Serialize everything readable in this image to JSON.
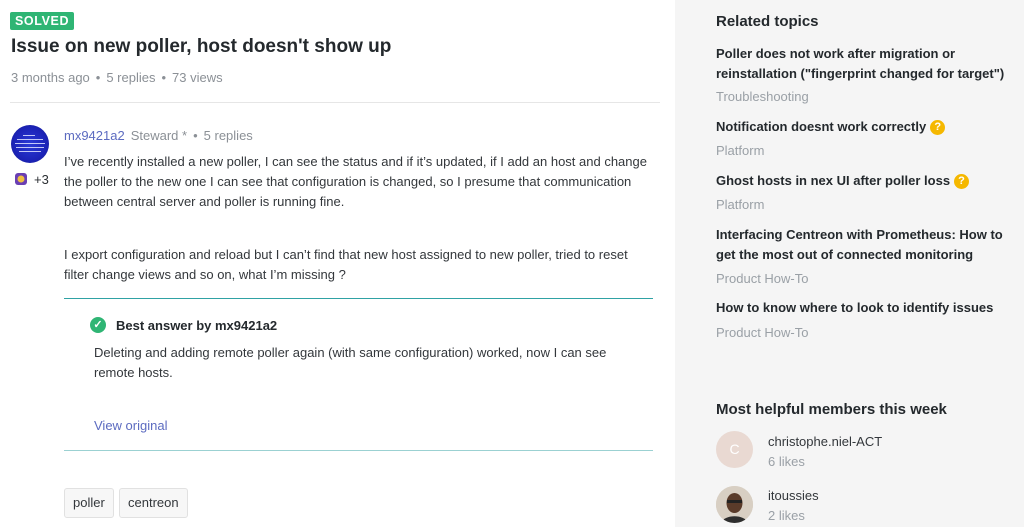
{
  "topic": {
    "status_badge": "SOLVED",
    "title": "Issue on new poller, host doesn't show up",
    "age": "3 months ago",
    "replies": "5 replies",
    "views": "73 views"
  },
  "post": {
    "author": "mx9421a2",
    "role": "Steward *",
    "replies": "5 replies",
    "badge_count": "+3",
    "paragraphs": [
      "I’ve recently installed a new poller, I can see the status and if it’s updated, if I add an host and change the poller to the new one I can see that configuration is changed, so I presume that communication between central server and poller is running fine.",
      "I export configuration and reload but I can’t find that new host assigned to new poller, tried to reset filter change views and so on, what I’m missing ?"
    ]
  },
  "best_answer": {
    "heading": "Best answer by mx9421a2",
    "text": "Deleting and adding remote poller again (with same configuration) worked, now I can see remote hosts.",
    "link": "View original"
  },
  "tags": [
    "poller",
    "centreon"
  ],
  "sidebar": {
    "related_heading": "Related topics",
    "related": [
      {
        "title": "Poller does not work after migration or reinstallation (\"fingerprint changed for target\")",
        "category": "Troubleshooting",
        "question": false
      },
      {
        "title": "Notification doesnt work correctly",
        "category": "Platform",
        "question": true
      },
      {
        "title": "Ghost hosts in nex UI after poller loss",
        "category": "Platform",
        "question": true
      },
      {
        "title": "Interfacing Centreon with Prometheus: How to get the most out of connected monitoring",
        "category": "Product How-To",
        "question": false
      },
      {
        "title": "How to know where to look to identify issues",
        "category": "Product How-To",
        "question": false
      }
    ],
    "members_heading": "Most helpful members this week",
    "members": [
      {
        "initial": "C",
        "name": "christophe.niel-ACT",
        "likes": "6 likes"
      },
      {
        "initial": "",
        "name": "itoussies",
        "likes": "2 likes"
      }
    ]
  },
  "colors": {
    "solved": "#2fb574",
    "link": "#5c6bc0",
    "accent_line": "#2fa2a4",
    "question_badge": "#f5b800",
    "sidebar_bg": "#f5f5f5"
  },
  "icons": {
    "check": "✓",
    "question": "?"
  }
}
